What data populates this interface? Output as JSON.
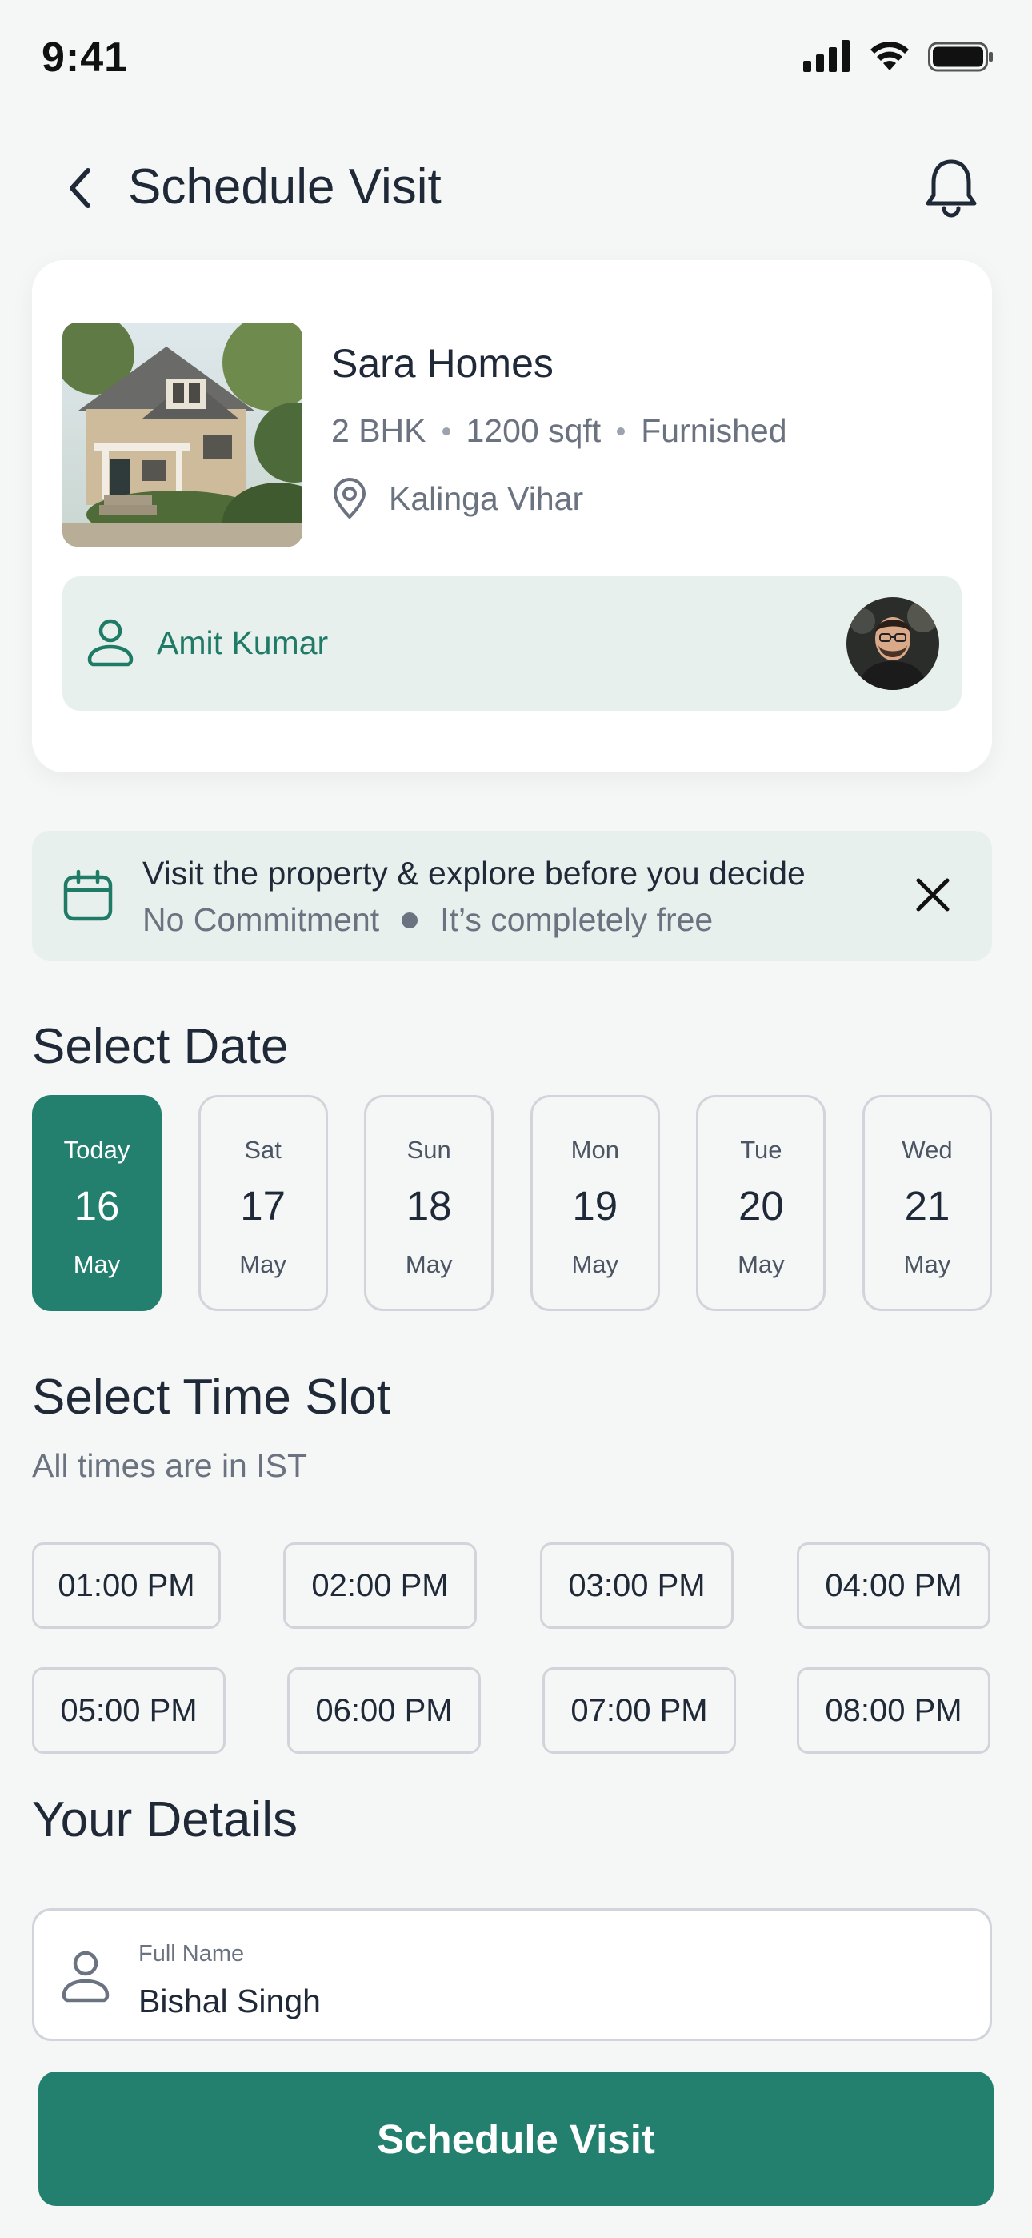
{
  "status_bar": {
    "time": "9:41"
  },
  "header": {
    "title": "Schedule Visit"
  },
  "property": {
    "name": "Sara Homes",
    "bhk": "2 BHK",
    "area": "1200 sqft",
    "furnishing": "Furnished",
    "location": "Kalinga Vihar",
    "agent_name": "Amit Kumar"
  },
  "banner": {
    "title": "Visit the property & explore before you decide",
    "point_1": "No Commitment",
    "point_2": "It’s completely free"
  },
  "date_section": {
    "title": "Select Date",
    "dates": [
      {
        "day": "Today",
        "num": "16",
        "month": "May",
        "selected": true
      },
      {
        "day": "Sat",
        "num": "17",
        "month": "May",
        "selected": false
      },
      {
        "day": "Sun",
        "num": "18",
        "month": "May",
        "selected": false
      },
      {
        "day": "Mon",
        "num": "19",
        "month": "May",
        "selected": false
      },
      {
        "day": "Tue",
        "num": "20",
        "month": "May",
        "selected": false
      },
      {
        "day": "Wed",
        "num": "21",
        "month": "May",
        "selected": false
      }
    ]
  },
  "time_section": {
    "title": "Select Time Slot",
    "note": "All times are in IST",
    "slots": [
      "01:00 PM",
      "02:00 PM",
      "03:00 PM",
      "04:00 PM",
      "05:00 PM",
      "06:00 PM",
      "07:00 PM",
      "08:00 PM"
    ]
  },
  "details_section": {
    "title": "Your Details",
    "full_name_label": "Full Name",
    "full_name_value": "Bishal Singh"
  },
  "cta": {
    "label": "Schedule Visit"
  },
  "colors": {
    "accent": "#237f6e",
    "accent_light": "#e8f0ee",
    "background": "#f5f7f6"
  }
}
